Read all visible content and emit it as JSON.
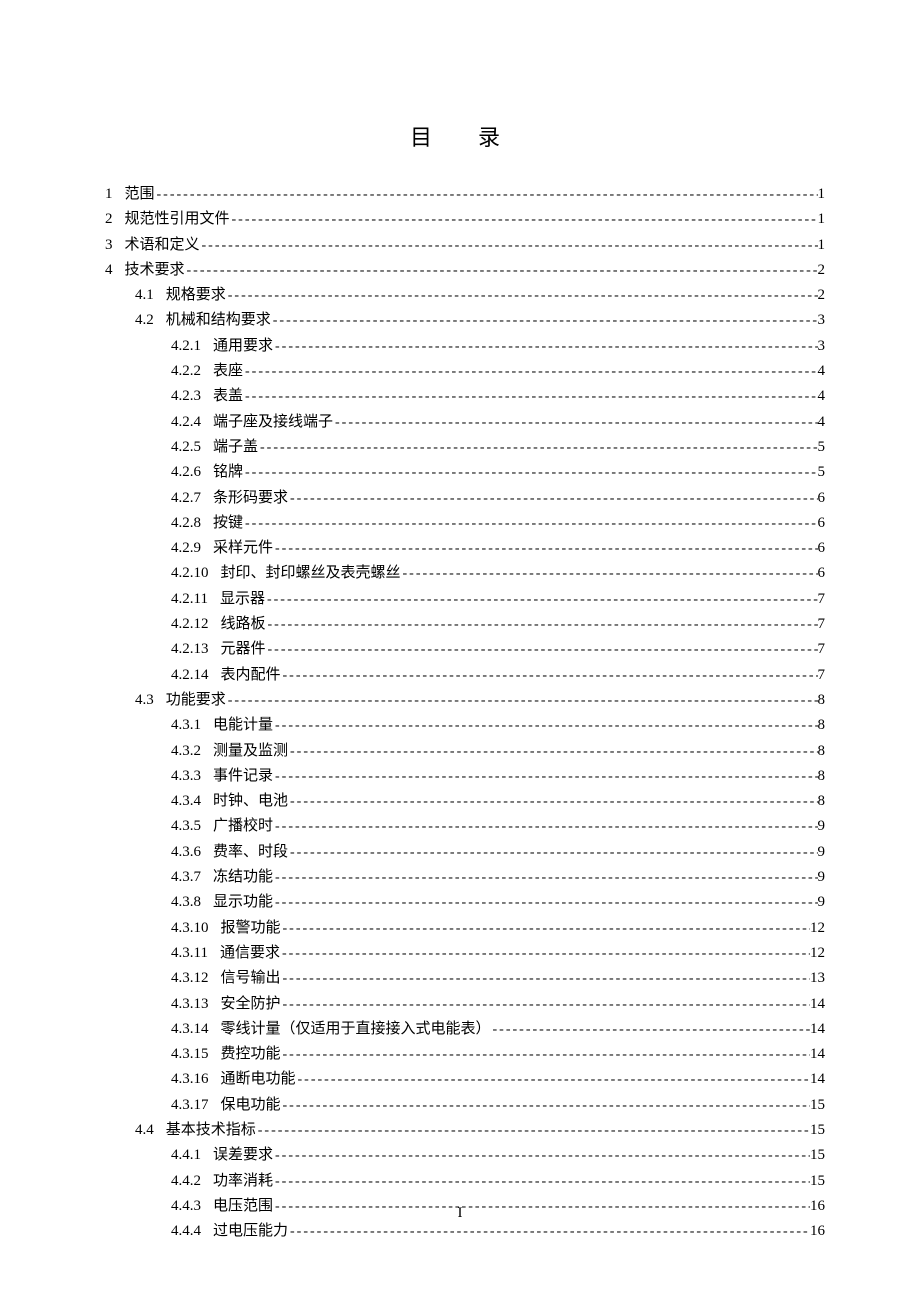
{
  "title": "目  录",
  "footer": "I",
  "entries": [
    {
      "level": 0,
      "num": "1",
      "text": "范围",
      "page": "1"
    },
    {
      "level": 0,
      "num": "2",
      "text": "规范性引用文件",
      "page": "1"
    },
    {
      "level": 0,
      "num": "3",
      "text": "术语和定义",
      "page": "1"
    },
    {
      "level": 0,
      "num": "4",
      "text": "技术要求",
      "page": "2"
    },
    {
      "level": 1,
      "num": "4.1",
      "text": "规格要求",
      "page": "2"
    },
    {
      "level": 1,
      "num": "4.2",
      "text": "机械和结构要求",
      "page": "3"
    },
    {
      "level": 2,
      "num": "4.2.1",
      "text": "通用要求",
      "page": "3"
    },
    {
      "level": 2,
      "num": "4.2.2",
      "text": "表座",
      "page": "4"
    },
    {
      "level": 2,
      "num": "4.2.3",
      "text": "表盖",
      "page": "4"
    },
    {
      "level": 2,
      "num": "4.2.4",
      "text": "端子座及接线端子",
      "page": "4"
    },
    {
      "level": 2,
      "num": "4.2.5",
      "text": "端子盖",
      "page": "5"
    },
    {
      "level": 2,
      "num": "4.2.6",
      "text": "铭牌",
      "page": "5"
    },
    {
      "level": 2,
      "num": "4.2.7",
      "text": "条形码要求",
      "page": "6"
    },
    {
      "level": 2,
      "num": "4.2.8",
      "text": "按键",
      "page": "6"
    },
    {
      "level": 2,
      "num": "4.2.9",
      "text": "采样元件",
      "page": "6"
    },
    {
      "level": 2,
      "num": "4.2.10",
      "text": "封印、封印螺丝及表壳螺丝",
      "page": "6"
    },
    {
      "level": 2,
      "num": "4.2.11",
      "text": "显示器",
      "page": "7"
    },
    {
      "level": 2,
      "num": "4.2.12",
      "text": "线路板",
      "page": "7"
    },
    {
      "level": 2,
      "num": "4.2.13",
      "text": "元器件",
      "page": "7"
    },
    {
      "level": 2,
      "num": "4.2.14",
      "text": "表内配件",
      "page": "7"
    },
    {
      "level": 1,
      "num": "4.3",
      "text": "功能要求",
      "page": "8"
    },
    {
      "level": 2,
      "num": "4.3.1",
      "text": "电能计量",
      "page": "8"
    },
    {
      "level": 2,
      "num": "4.3.2",
      "text": "测量及监测",
      "page": "8"
    },
    {
      "level": 2,
      "num": "4.3.3",
      "text": "事件记录",
      "page": "8"
    },
    {
      "level": 2,
      "num": "4.3.4",
      "text": "时钟、电池",
      "page": "8"
    },
    {
      "level": 2,
      "num": "4.3.5",
      "text": "广播校时",
      "page": "9"
    },
    {
      "level": 2,
      "num": "4.3.6",
      "text": "费率、时段",
      "page": "9"
    },
    {
      "level": 2,
      "num": "4.3.7",
      "text": "冻结功能",
      "page": "9"
    },
    {
      "level": 2,
      "num": "4.3.8",
      "text": "显示功能",
      "page": "9"
    },
    {
      "level": 2,
      "num": "4.3.10",
      "text": "报警功能",
      "page": "12"
    },
    {
      "level": 2,
      "num": "4.3.11",
      "text": "通信要求",
      "page": "12"
    },
    {
      "level": 2,
      "num": "4.3.12",
      "text": "信号输出",
      "page": "13"
    },
    {
      "level": 2,
      "num": "4.3.13",
      "text": "安全防护",
      "page": "14"
    },
    {
      "level": 2,
      "num": "4.3.14",
      "text": "零线计量（仅适用于直接接入式电能表）",
      "page": "14"
    },
    {
      "level": 2,
      "num": "4.3.15",
      "text": "费控功能",
      "page": "14"
    },
    {
      "level": 2,
      "num": "4.3.16",
      "text": "通断电功能",
      "page": "14"
    },
    {
      "level": 2,
      "num": "4.3.17",
      "text": "保电功能",
      "page": "15"
    },
    {
      "level": 1,
      "num": "4.4",
      "text": "基本技术指标",
      "page": "15"
    },
    {
      "level": 2,
      "num": "4.4.1",
      "text": "误差要求",
      "page": "15"
    },
    {
      "level": 2,
      "num": "4.4.2",
      "text": "功率消耗",
      "page": "15"
    },
    {
      "level": 2,
      "num": "4.4.3",
      "text": "电压范围",
      "page": "16"
    },
    {
      "level": 2,
      "num": "4.4.4",
      "text": "过电压能力",
      "page": "16"
    }
  ]
}
